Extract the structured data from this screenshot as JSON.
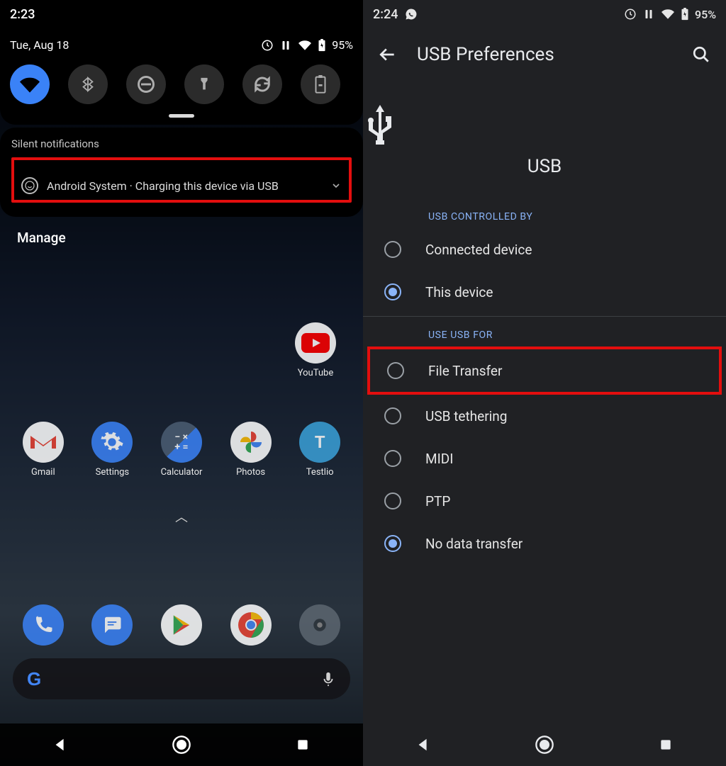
{
  "left": {
    "status_time": "2:23",
    "battery": "95%",
    "date": "Tue, Aug 18",
    "silent_notifications_title": "Silent notifications",
    "notification_app": "Android System",
    "notification_sep": " · ",
    "notification_text": "Charging this device via USB",
    "manage": "Manage",
    "apps_youtube": "YouTube",
    "apps": {
      "gmail": "Gmail",
      "settings": "Settings",
      "calculator": "Calculator",
      "photos": "Photos",
      "testlio": "Testlio"
    }
  },
  "right": {
    "status_time": "2:24",
    "battery": "95%",
    "title": "USB Preferences",
    "hero_label": "USB",
    "section_controlled": "USB CONTROLLED BY",
    "opt_connected": "Connected device",
    "opt_this": "This device",
    "section_use": "USE USB FOR",
    "opt_file": "File Transfer",
    "opt_tether": "USB tethering",
    "opt_midi": "MIDI",
    "opt_ptp": "PTP",
    "opt_none": "No data transfer"
  }
}
